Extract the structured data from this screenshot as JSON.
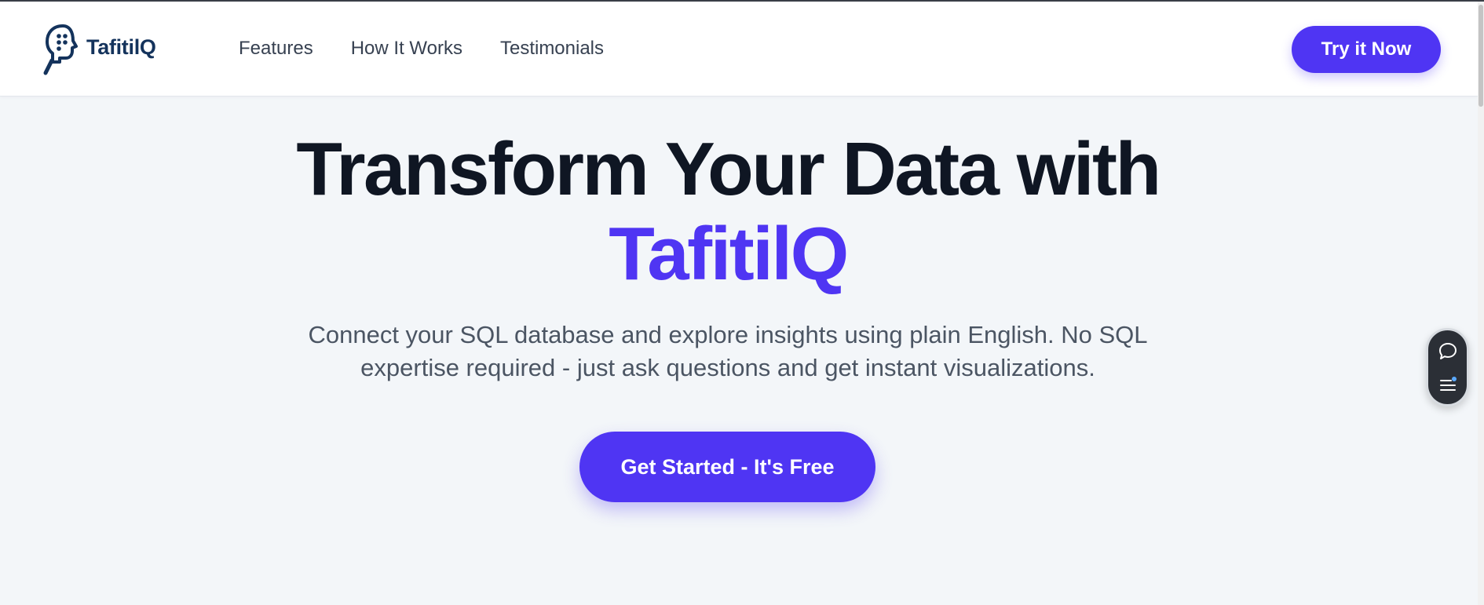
{
  "brand": {
    "name": "TafitilQ",
    "color": "#14335c",
    "accent": "#4f35f3"
  },
  "nav": {
    "items": [
      {
        "label": "Features"
      },
      {
        "label": "How It Works"
      },
      {
        "label": "Testimonials"
      }
    ],
    "cta_label": "Try it Now"
  },
  "hero": {
    "title_line1": "Transform Your Data with",
    "title_accent": "TafitilQ",
    "subtitle": "Connect your SQL database and explore insights using plain English. No SQL expertise required - just ask questions and get instant visualizations.",
    "cta_label": "Get Started - It's Free"
  },
  "widget": {
    "icons": [
      "chat-bubble-icon",
      "menu-icon"
    ]
  }
}
